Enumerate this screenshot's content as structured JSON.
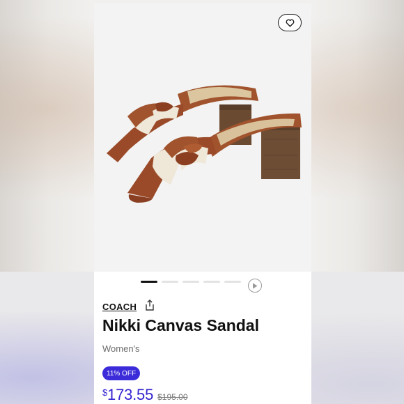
{
  "product": {
    "brand": "COACH",
    "title": "Nikki Canvas Sandal",
    "gender": "Women's",
    "discount_badge": "11% OFF",
    "price_currency": "$",
    "price_value": "173.55",
    "original_price": "$195.00"
  },
  "gallery": {
    "total_images": 5,
    "active_index": 0,
    "has_video": true
  },
  "icons": {
    "favorite": "heart-icon",
    "share": "share-icon",
    "video": "play-icon"
  },
  "colors": {
    "accent": "#3b2bd8",
    "price": "#3424d0",
    "leather": "#9a4a28",
    "canvas": "#efe7d8",
    "heel": "#6b4a32"
  }
}
